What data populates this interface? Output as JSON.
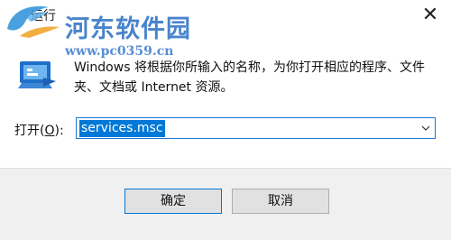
{
  "window": {
    "title": "运行",
    "close_glyph": "✕"
  },
  "watermark": {
    "site_name": "河东软件园",
    "url": "www.pc0359.cn"
  },
  "description": "Windows 将根据你所输入的名称，为你打开相应的程序、文件夹、文档或 Internet 资源。",
  "open_field": {
    "label_prefix": "打开(",
    "label_mnemonic": "O",
    "label_suffix": "):",
    "value": "services.msc"
  },
  "buttons": {
    "ok": "确定",
    "cancel": "取消"
  },
  "colors": {
    "accent": "#0078d7",
    "watermark_blue": "#2a6fc4",
    "footer_bg": "#f0f0f0"
  },
  "icons": [
    "app-icon",
    "close-icon",
    "run-icon",
    "chevron-down-icon"
  ]
}
